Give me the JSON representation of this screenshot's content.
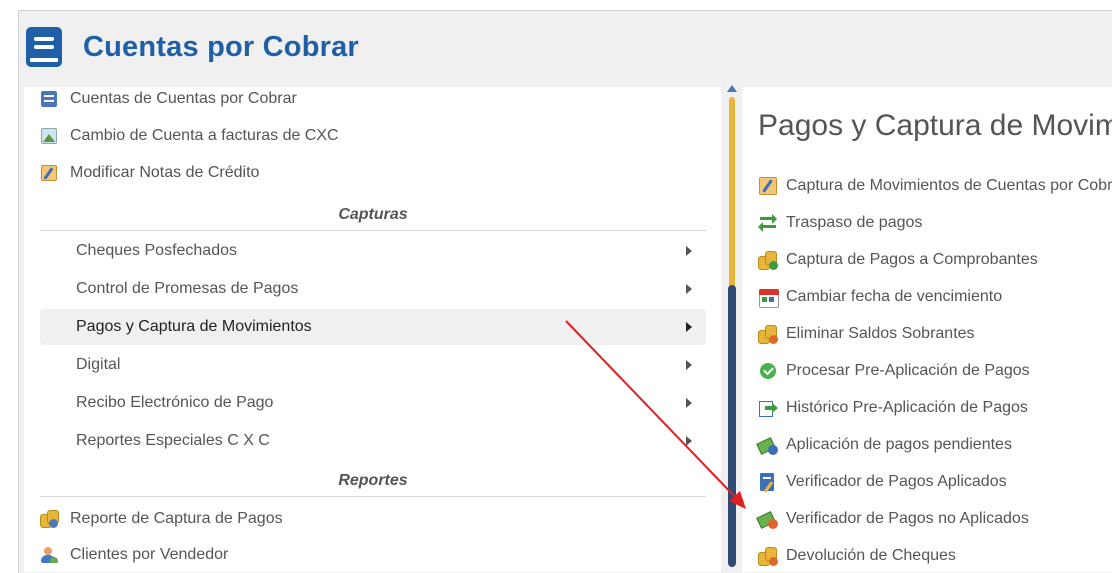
{
  "app": {
    "title": "Cuentas por Cobrar"
  },
  "left": {
    "top_items": [
      {
        "label": "Cuentas de Cuentas por Cobrar",
        "icon": "ledger-icon"
      },
      {
        "label": "Cambio de Cuenta a facturas de CXC",
        "icon": "image-icon"
      },
      {
        "label": "Modificar Notas de Crédito",
        "icon": "edit-note-icon"
      }
    ],
    "capturas_heading": "Capturas",
    "capturas": [
      {
        "label": "Cheques Posfechados"
      },
      {
        "label": "Control de Promesas de Pagos"
      },
      {
        "label": "Pagos y Captura de Movimientos",
        "active": true
      },
      {
        "label": "Digital"
      },
      {
        "label": "Recibo Electrónico de Pago"
      },
      {
        "label": "Reportes Especiales C X C"
      }
    ],
    "reportes_heading": "Reportes",
    "reportes": [
      {
        "label": "Reporte de Captura de Pagos",
        "icon": "coins-user-icon"
      },
      {
        "label": "Clientes por Vendedor",
        "icon": "users-icon"
      }
    ]
  },
  "right": {
    "title": "Pagos y Captura de Movimientos",
    "items": [
      {
        "label": "Captura de Movimientos de Cuentas por Cobrar",
        "icon": "edit-note-icon"
      },
      {
        "label": "Traspaso de pagos",
        "icon": "transfer-icon"
      },
      {
        "label": "Captura de Pagos a Comprobantes",
        "icon": "coins-add-icon"
      },
      {
        "label": "Cambiar fecha de vencimiento",
        "icon": "calendar-icon"
      },
      {
        "label": "Eliminar Saldos Sobrantes",
        "icon": "coins-remove-icon"
      },
      {
        "label": "Procesar Pre-Aplicación de Pagos",
        "icon": "check-circle-icon"
      },
      {
        "label": "Histórico Pre-Aplicación de Pagos",
        "icon": "history-icon"
      },
      {
        "label": "Aplicación de pagos pendientes",
        "icon": "money-clock-icon"
      },
      {
        "label": "Verificador de Pagos Aplicados",
        "icon": "document-check-icon"
      },
      {
        "label": "Verificador de Pagos no Aplicados",
        "icon": "money-error-icon"
      },
      {
        "label": "Devolución de Cheques",
        "icon": "coins-return-icon"
      }
    ]
  },
  "colors": {
    "brand": "#1f5fa8",
    "annotation_arrow": "#e02020",
    "scroll_thumb": "#2c4a73",
    "scroll_track": "#e6b53a"
  }
}
